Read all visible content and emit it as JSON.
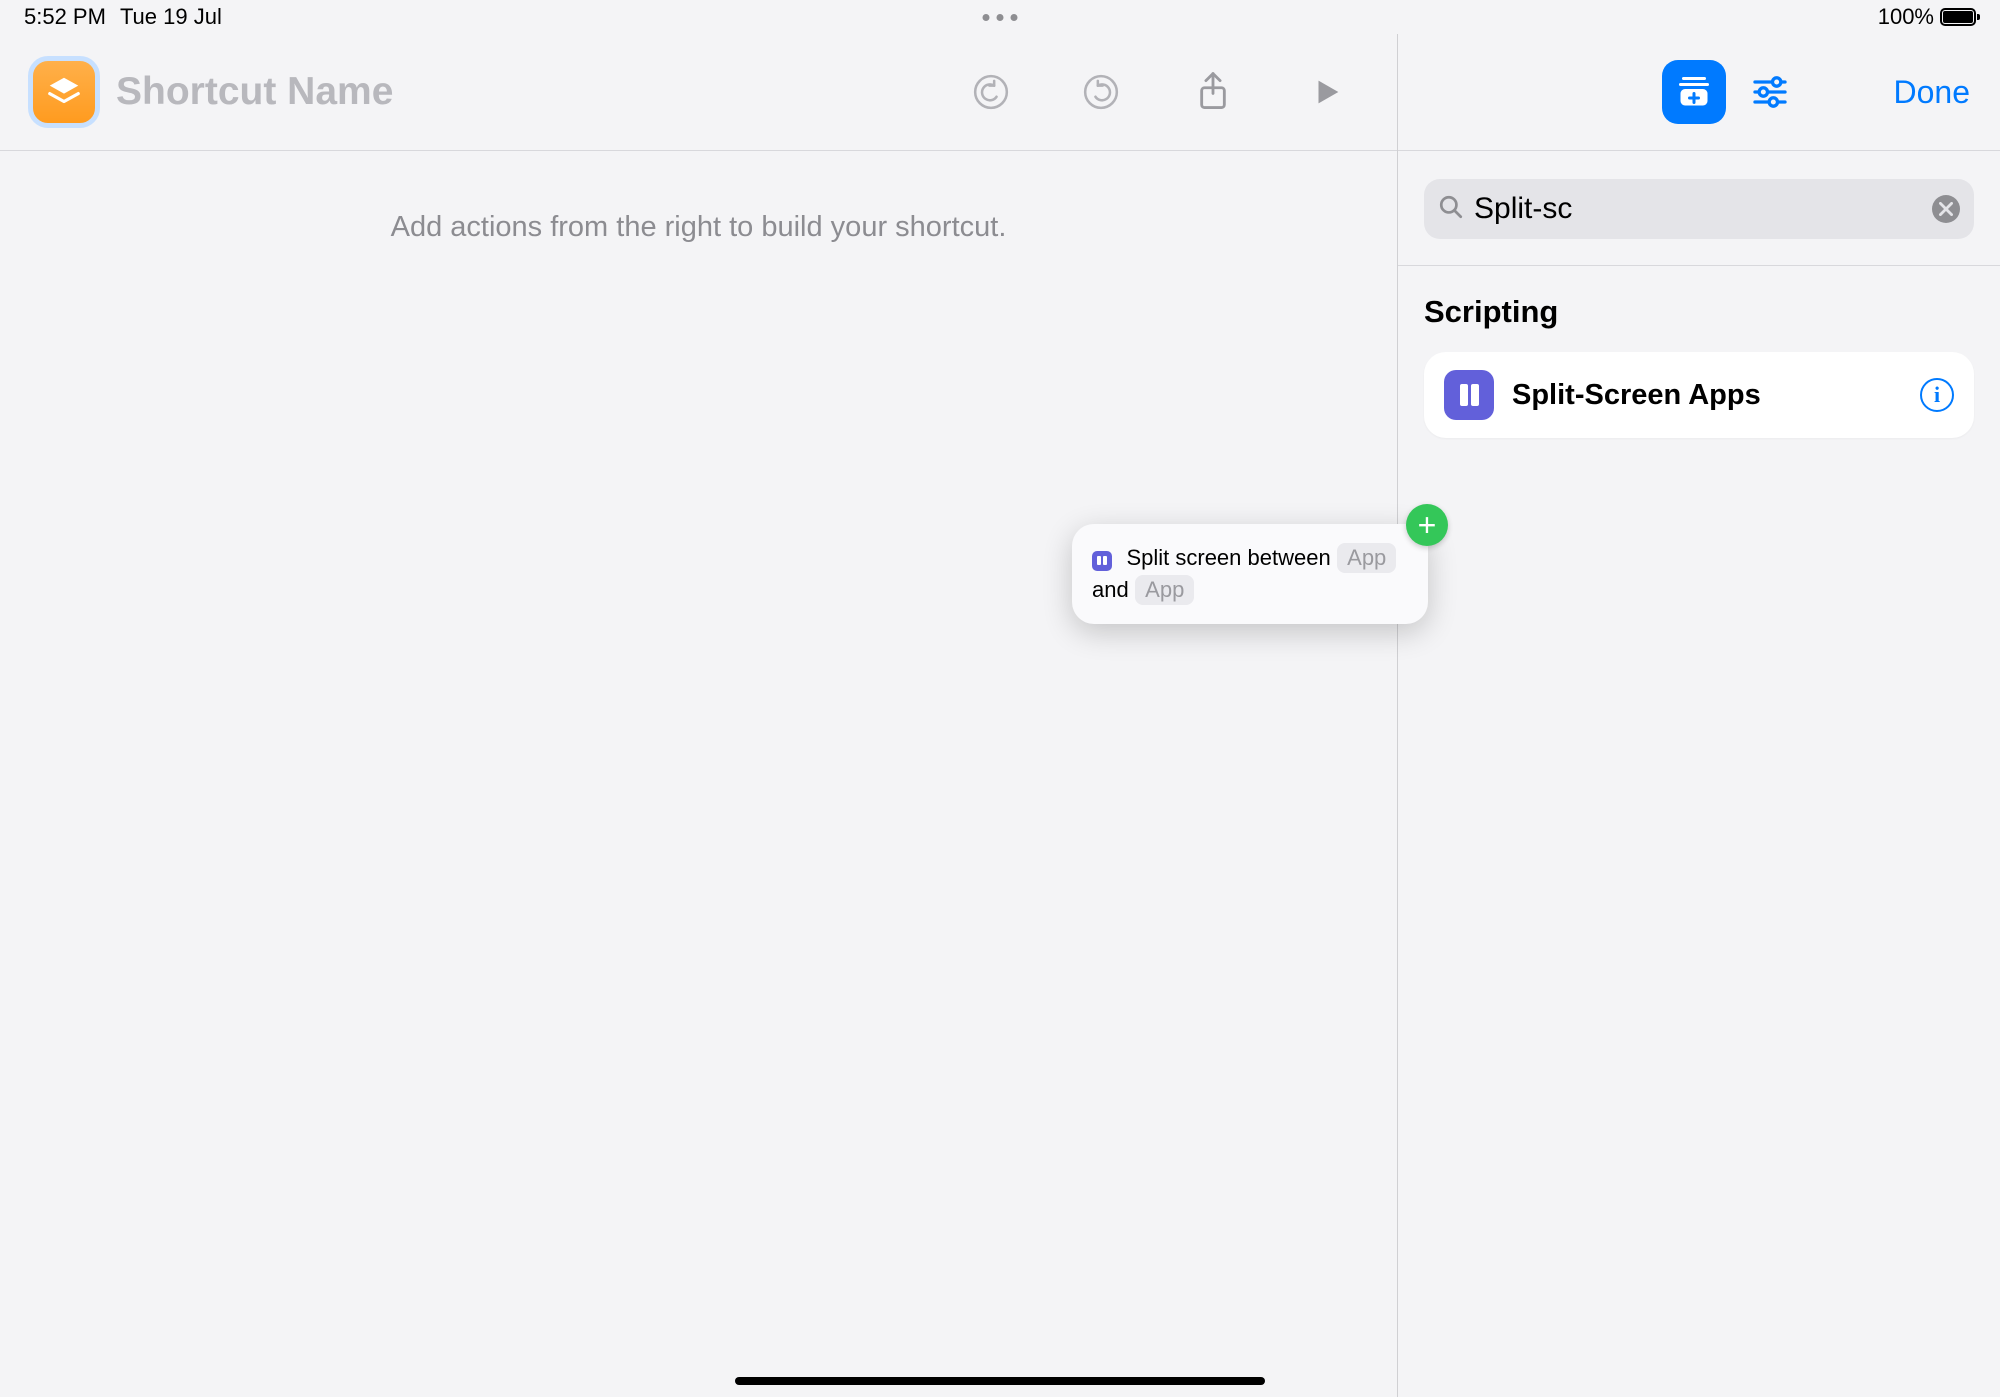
{
  "status": {
    "time": "5:52 PM",
    "date": "Tue 19 Jul",
    "battery_pct": "100%"
  },
  "editor": {
    "title_placeholder": "Shortcut Name",
    "hint": "Add actions from the right to build your shortcut."
  },
  "drag_card": {
    "prefix": "Split screen between",
    "token1": "App",
    "joiner": "and",
    "token2": "App"
  },
  "side": {
    "done_label": "Done",
    "search_value": "Split-sc",
    "section_title": "Scripting",
    "result_title": "Split-Screen Apps"
  }
}
